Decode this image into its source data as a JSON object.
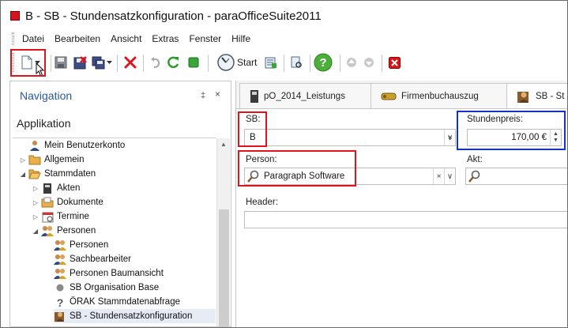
{
  "window": {
    "title": "B - SB - Stundensatzkonfiguration - paraOfficeSuite2011"
  },
  "menu": {
    "items": [
      "Datei",
      "Bearbeiten",
      "Ansicht",
      "Extras",
      "Fenster",
      "Hilfe"
    ]
  },
  "toolbar": {
    "start_label": "Start",
    "buttons": [
      "new-document-icon",
      "save-icon",
      "save-close-icon",
      "save-as-icon",
      "delete-icon",
      "undo-icon",
      "refresh-icon",
      "stop-icon",
      "start-icon",
      "export-icon",
      "print-preview-icon",
      "help-icon",
      "up-icon",
      "down-icon",
      "close-red-icon"
    ]
  },
  "navigation": {
    "header": "Navigation",
    "pin": "‡",
    "close": "×",
    "section": "Applikation",
    "tree": [
      {
        "label": "Mein Benutzerkonto",
        "level": 1,
        "expander": "",
        "icon": "user-icon"
      },
      {
        "label": "Allgemein",
        "level": 1,
        "expander": "▷",
        "icon": "folder-icon"
      },
      {
        "label": "Stammdaten",
        "level": 1,
        "expander": "◢",
        "icon": "folder-open-icon"
      },
      {
        "label": "Akten",
        "level": 2,
        "expander": "▷",
        "icon": "binder-icon"
      },
      {
        "label": "Dokumente",
        "level": 2,
        "expander": "▷",
        "icon": "documents-icon"
      },
      {
        "label": "Termine",
        "level": 2,
        "expander": "▷",
        "icon": "calendar-icon"
      },
      {
        "label": "Personen",
        "level": 2,
        "expander": "◢",
        "icon": "people-icon"
      },
      {
        "label": "Personen",
        "level": 3,
        "expander": "",
        "icon": "people-icon"
      },
      {
        "label": "Sachbearbeiter",
        "level": 3,
        "expander": "",
        "icon": "people-icon"
      },
      {
        "label": "Personen Baumansicht",
        "level": 3,
        "expander": "",
        "icon": "people-icon"
      },
      {
        "label": "SB Organisation Base",
        "level": 3,
        "expander": "",
        "icon": "grey-dot-icon"
      },
      {
        "label": "ÖRAK Stammdatenabfrage",
        "level": 3,
        "expander": "",
        "icon": "question-icon"
      },
      {
        "label": "SB - Stundensatzkonfiguration",
        "level": 3,
        "expander": "",
        "icon": "person-clock-icon",
        "selected": true
      }
    ]
  },
  "tabs": [
    {
      "label": "pO_2014_Leistungs",
      "icon": "binder-icon"
    },
    {
      "label": "Firmenbuchauszug",
      "icon": "key-icon"
    },
    {
      "label": "SB - St",
      "icon": "person-clock-icon"
    }
  ],
  "form": {
    "sb": {
      "label": "SB:",
      "value": "B"
    },
    "stundenpreis": {
      "label": "Stundenpreis:",
      "value": "170,00 €"
    },
    "person": {
      "label": "Person:",
      "value": "Paragraph Software"
    },
    "akt": {
      "label": "Akt:",
      "value": ""
    },
    "header": {
      "label": "Header:",
      "value": ""
    }
  },
  "colors": {
    "highlight_red": "#e0141a",
    "highlight_blue": "#1531c7",
    "nav_header": "#2b5a9a"
  }
}
